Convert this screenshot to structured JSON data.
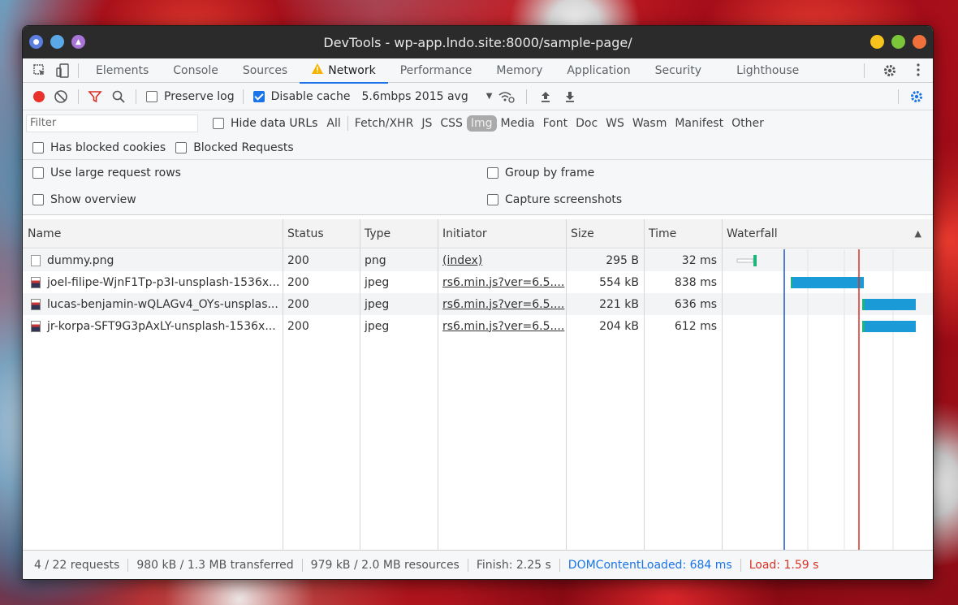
{
  "window": {
    "title": "DevTools - wp-app.lndo.site:8000/sample-page/"
  },
  "tabs": [
    {
      "label": "Elements"
    },
    {
      "label": "Console"
    },
    {
      "label": "Sources"
    },
    {
      "label": "Network"
    },
    {
      "label": "Performance"
    },
    {
      "label": "Memory"
    },
    {
      "label": "Application"
    },
    {
      "label": "Security"
    },
    {
      "label": "Lighthouse"
    }
  ],
  "toolbar": {
    "preserve_log": "Preserve log",
    "disable_cache": "Disable cache",
    "throttling": "5.6mbps 2015 avg"
  },
  "filter": {
    "placeholder": "Filter",
    "hide_data_urls": "Hide data URLs",
    "types": [
      "All",
      "Fetch/XHR",
      "JS",
      "CSS",
      "Img",
      "Media",
      "Font",
      "Doc",
      "WS",
      "Wasm",
      "Manifest",
      "Other"
    ],
    "selected_type": "Img",
    "has_blocked_cookies": "Has blocked cookies",
    "blocked_requests": "Blocked Requests"
  },
  "settings": {
    "large_rows": "Use large request rows",
    "group_by_frame": "Group by frame",
    "show_overview": "Show overview",
    "capture_screenshots": "Capture screenshots"
  },
  "columns": [
    "Name",
    "Status",
    "Type",
    "Initiator",
    "Size",
    "Time",
    "Waterfall"
  ],
  "requests": [
    {
      "name": "dummy.png",
      "status": "200",
      "type": "png",
      "initiator": "(index)",
      "size": "295 B",
      "time": "32 ms",
      "icon": "blank-file-icon"
    },
    {
      "name": "joel-filipe-WjnF1Tp-p3I-unsplash-1536x...",
      "status": "200",
      "type": "jpeg",
      "initiator": "rs6.min.js?ver=6.5....",
      "size": "554 kB",
      "time": "838 ms",
      "icon": "image-file-icon"
    },
    {
      "name": "lucas-benjamin-wQLAGv4_OYs-unsplas...",
      "status": "200",
      "type": "jpeg",
      "initiator": "rs6.min.js?ver=6.5....",
      "size": "221 kB",
      "time": "636 ms",
      "icon": "image-file-icon"
    },
    {
      "name": "jr-korpa-SFT9G3pAxLY-unsplash-1536x...",
      "status": "200",
      "type": "jpeg",
      "initiator": "rs6.min.js?ver=6.5....",
      "size": "204 kB",
      "time": "612 ms",
      "icon": "image-file-icon"
    }
  ],
  "status": {
    "requests": "4 / 22 requests",
    "transferred": "980 kB / 1.3 MB transferred",
    "resources": "979 kB / 2.0 MB resources",
    "finish": "Finish: 2.25 s",
    "dom_content_loaded": "DOMContentLoaded: 684 ms",
    "load": "Load: 1.59 s"
  },
  "colors": {
    "accent": "#1a73e8",
    "dcl_line": "#1a52c8",
    "load_line": "#d93025",
    "bar": "#1a9ad6",
    "bar_start": "#1fb57a",
    "warning": "#f4b400"
  }
}
